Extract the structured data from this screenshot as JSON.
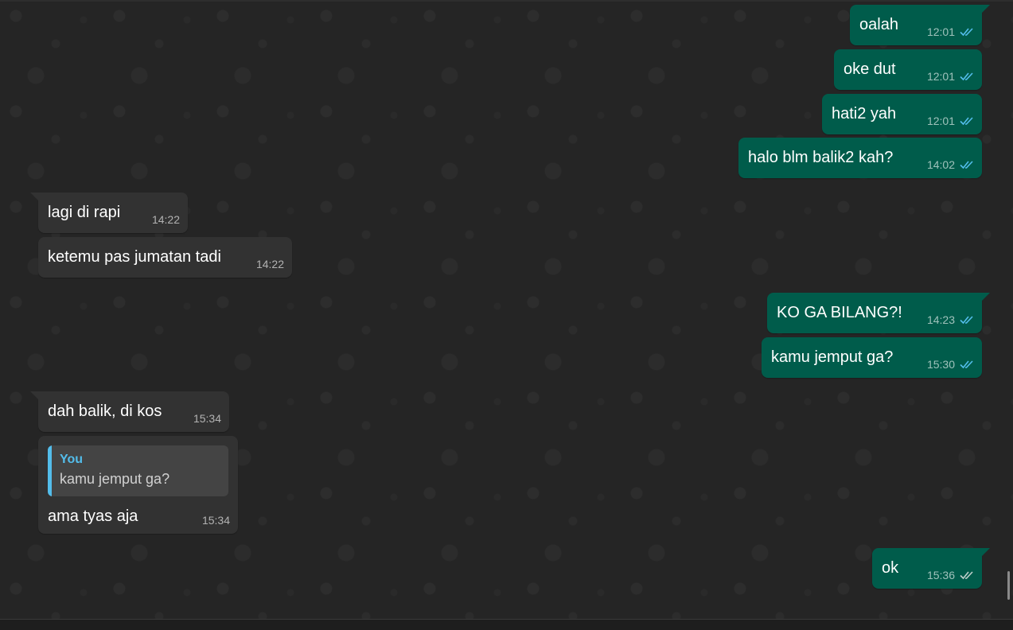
{
  "colors": {
    "outgoing_bubble": "#005c4b",
    "incoming_bubble": "#323232",
    "chat_background": "#252525",
    "read_check": "#53bdeb",
    "quote_accent": "#53bdeb"
  },
  "messages": [
    {
      "direction": "out",
      "text": "oalah",
      "time": "12:01",
      "status_icon": "double-check-read-icon"
    },
    {
      "direction": "out",
      "text": "oke dut",
      "time": "12:01",
      "status_icon": "double-check-read-icon"
    },
    {
      "direction": "out",
      "text": "hati2 yah",
      "time": "12:01",
      "status_icon": "double-check-read-icon"
    },
    {
      "direction": "out",
      "text": "halo blm balik2 kah?",
      "time": "14:02",
      "status_icon": "double-check-read-icon"
    },
    {
      "direction": "in",
      "text": "lagi di rapi",
      "time": "14:22"
    },
    {
      "direction": "in",
      "text": "ketemu pas jumatan tadi",
      "time": "14:22"
    },
    {
      "direction": "out",
      "text": "KO GA BILANG?!",
      "time": "14:23",
      "status_icon": "double-check-read-icon"
    },
    {
      "direction": "out",
      "text": "kamu jemput ga?",
      "time": "15:30",
      "status_icon": "double-check-read-icon"
    },
    {
      "direction": "in",
      "text": "dah balik, di kos",
      "time": "15:34"
    },
    {
      "direction": "in",
      "text": "ama tyas aja",
      "time": "15:34",
      "quoted": {
        "author": "You",
        "text": "kamu jemput ga?"
      }
    },
    {
      "direction": "out",
      "text": "ok",
      "time": "15:36",
      "status_icon": "double-check-delivered-icon"
    }
  ]
}
